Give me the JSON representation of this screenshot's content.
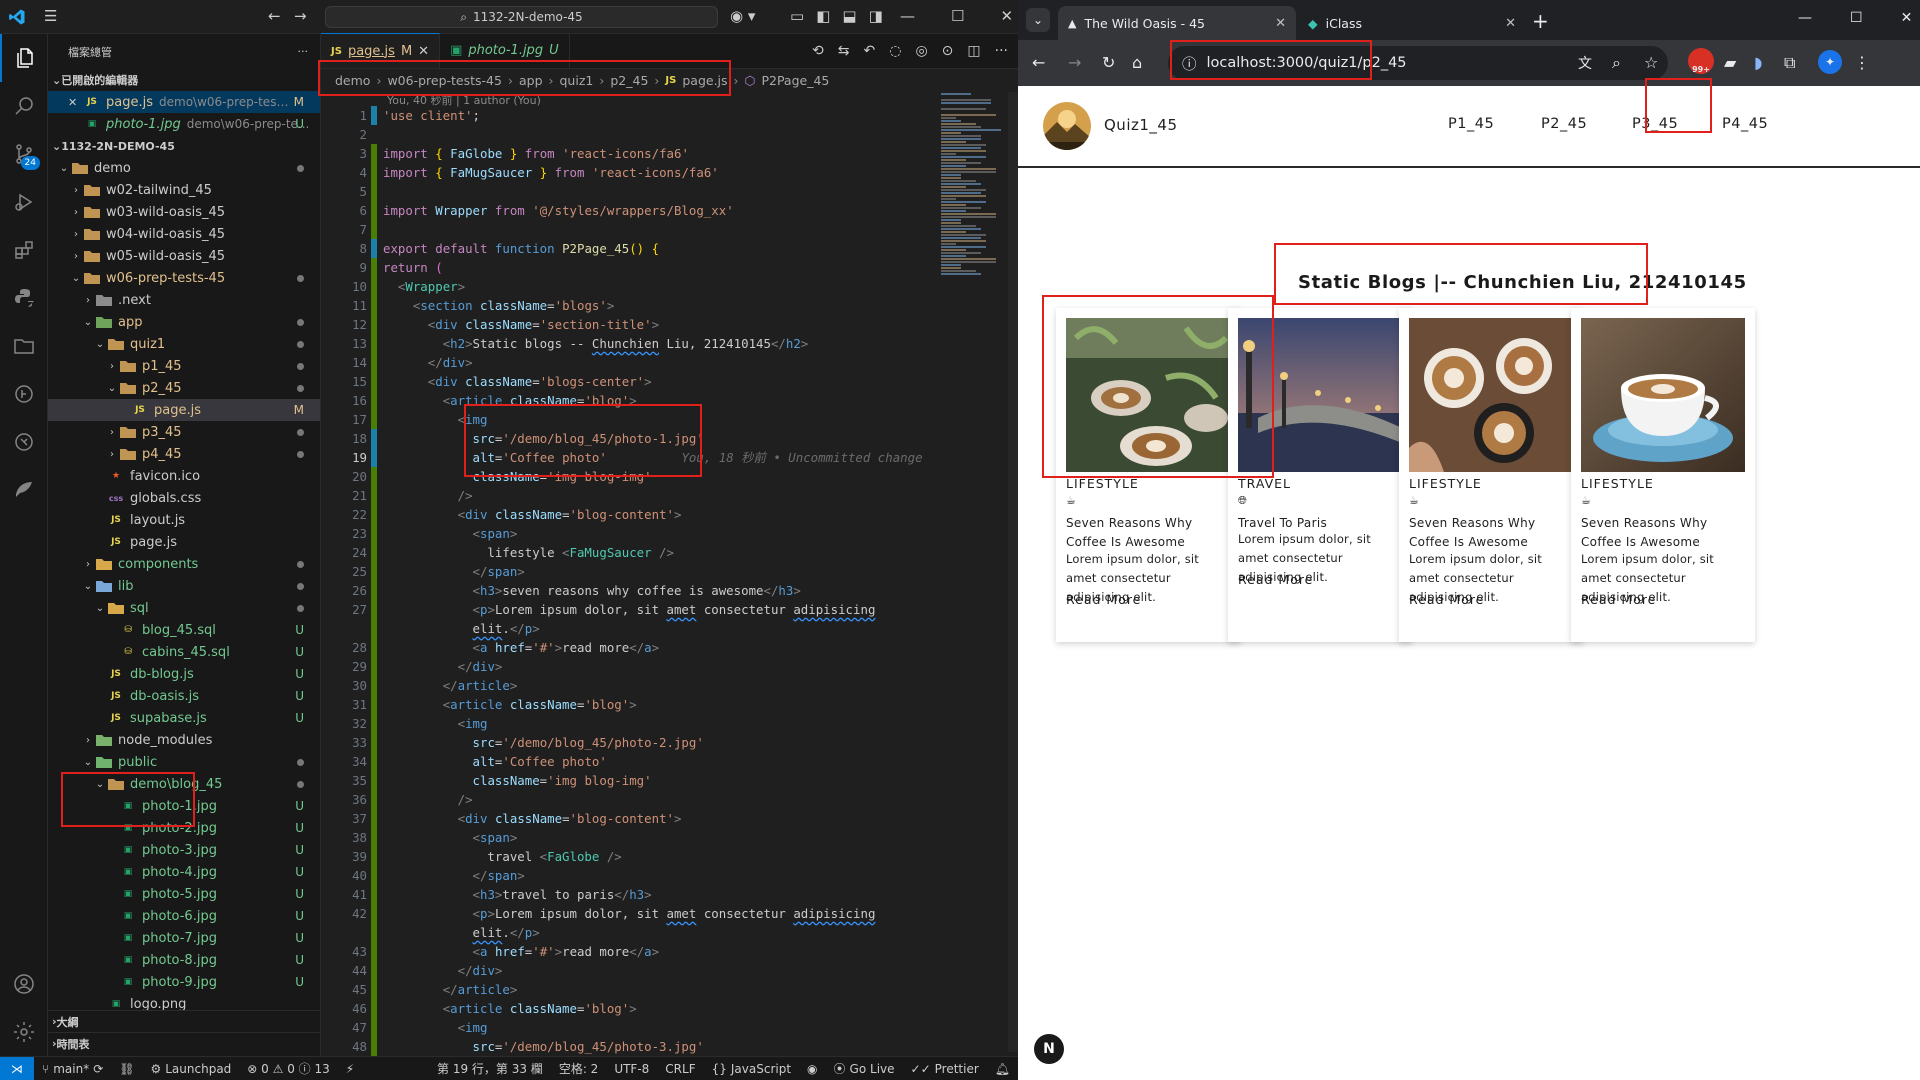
{
  "vscode": {
    "command_center": "1132-2N-demo-45",
    "explorer_title": "檔案總管",
    "explorer_more": "···",
    "open_editors_title": "已開啟的編輯器",
    "open_editors": [
      {
        "close": "✕",
        "name": "page.js",
        "desc": "demo\\w06-prep-tests-...",
        "status": "M"
      },
      {
        "name": "photo-1.jpg",
        "desc": "demo\\w06-prep-te...",
        "status": "U"
      }
    ],
    "workspace_title": "1132-2N-DEMO-45",
    "tree": [
      {
        "name": "demo",
        "type": "folder",
        "open": true,
        "level": 1,
        "status": "dot"
      },
      {
        "name": "w02-tailwind_45",
        "type": "folder",
        "level": 2
      },
      {
        "name": "w03-wild-oasis_45",
        "type": "folder",
        "level": 2
      },
      {
        "name": "w04-wild-oasis_45",
        "type": "folder",
        "level": 2
      },
      {
        "name": "w05-wild-oasis_45",
        "type": "folder",
        "level": 2
      },
      {
        "name": "w06-prep-tests-45",
        "type": "folder",
        "open": true,
        "level": 2,
        "status": "dot",
        "color": "modified"
      },
      {
        "name": ".next",
        "type": "folder-next",
        "level": 3
      },
      {
        "name": "app",
        "type": "folder-app",
        "open": true,
        "level": 3,
        "status": "dot",
        "color": "modified"
      },
      {
        "name": "quiz1",
        "type": "folder",
        "open": true,
        "level": 4,
        "status": "dot",
        "color": "modified"
      },
      {
        "name": "p1_45",
        "type": "folder",
        "level": 5,
        "status": "dot",
        "color": "modified"
      },
      {
        "name": "p2_45",
        "type": "folder",
        "open": true,
        "level": 5,
        "status": "dot",
        "color": "modified"
      },
      {
        "name": "page.js",
        "type": "js",
        "level": 6,
        "status": "M",
        "color": "modified",
        "selected": true
      },
      {
        "name": "p3_45",
        "type": "folder",
        "level": 5,
        "status": "dot",
        "color": "modified"
      },
      {
        "name": "p4_45",
        "type": "folder",
        "level": 5,
        "status": "dot",
        "color": "modified"
      },
      {
        "name": "favicon.ico",
        "type": "fav",
        "level": 4
      },
      {
        "name": "globals.css",
        "type": "css",
        "level": 4
      },
      {
        "name": "layout.js",
        "type": "js",
        "level": 4
      },
      {
        "name": "page.js",
        "type": "js",
        "level": 4
      },
      {
        "name": "components",
        "type": "folder-comp",
        "level": 3,
        "status": "dot",
        "color": "untracked"
      },
      {
        "name": "lib",
        "type": "folder-lib",
        "open": true,
        "level": 3,
        "status": "dot",
        "color": "untracked"
      },
      {
        "name": "sql",
        "type": "folder-sql",
        "open": true,
        "level": 4,
        "status": "dot",
        "color": "untracked"
      },
      {
        "name": "blog_45.sql",
        "type": "db",
        "level": 5,
        "status": "U",
        "color": "untracked"
      },
      {
        "name": "cabins_45.sql",
        "type": "db",
        "level": 5,
        "status": "U",
        "color": "untracked"
      },
      {
        "name": "db-blog.js",
        "type": "js",
        "level": 4,
        "status": "U",
        "color": "untracked"
      },
      {
        "name": "db-oasis.js",
        "type": "js",
        "level": 4,
        "status": "U",
        "color": "untracked"
      },
      {
        "name": "supabase.js",
        "type": "js",
        "level": 4,
        "status": "U",
        "color": "untracked"
      },
      {
        "name": "node_modules",
        "type": "folder-node",
        "level": 3
      },
      {
        "name": "public",
        "type": "folder-public",
        "open": true,
        "level": 3,
        "status": "dot",
        "color": "untracked"
      },
      {
        "name": "demo\\blog_45",
        "type": "folder",
        "open": true,
        "level": 4,
        "status": "dot",
        "color": "untracked"
      },
      {
        "name": "photo-1.jpg",
        "type": "img",
        "level": 5,
        "status": "U",
        "color": "untracked"
      },
      {
        "name": "photo-2.jpg",
        "type": "img",
        "level": 5,
        "status": "U",
        "color": "untracked"
      },
      {
        "name": "photo-3.jpg",
        "type": "img",
        "level": 5,
        "status": "U",
        "color": "untracked"
      },
      {
        "name": "photo-4.jpg",
        "type": "img",
        "level": 5,
        "status": "U",
        "color": "untracked"
      },
      {
        "name": "photo-5.jpg",
        "type": "img",
        "level": 5,
        "status": "U",
        "color": "untracked"
      },
      {
        "name": "photo-6.jpg",
        "type": "img",
        "level": 5,
        "status": "U",
        "color": "untracked"
      },
      {
        "name": "photo-7.jpg",
        "type": "img",
        "level": 5,
        "status": "U",
        "color": "untracked"
      },
      {
        "name": "photo-8.jpg",
        "type": "img",
        "level": 5,
        "status": "U",
        "color": "untracked"
      },
      {
        "name": "photo-9.jpg",
        "type": "img",
        "level": 5,
        "status": "U",
        "color": "untracked"
      },
      {
        "name": "logo.png",
        "type": "img",
        "level": 4
      }
    ],
    "outline_title": "大綱",
    "timeline_title": "時間表",
    "tabs": [
      {
        "name": "page.js",
        "status": "M",
        "active": true
      },
      {
        "name": "photo-1.jpg",
        "status": "U",
        "active": false
      }
    ],
    "breadcrumb": [
      "demo",
      "w06-prep-tests-45",
      "app",
      "quiz1",
      "p2_45",
      "page.js",
      "P2Page_45"
    ],
    "codelens": "You, 40 秒前 | 1 author (You)",
    "inline_blame": "You, 18 秒前 • Uncommitted change",
    "activity_badge": "24",
    "status": {
      "branch": "main*",
      "launchpad": "Launchpad",
      "problems": "⊗ 0 ⚠ 0 ⓘ 13",
      "position": "第 19 行，第 33 欄",
      "spaces": "空格: 2",
      "encoding": "UTF-8",
      "eol": "CRLF",
      "language": "JavaScript",
      "golive": "Go Live",
      "prettier": "Prettier"
    }
  },
  "chrome": {
    "tabs": [
      {
        "title": "The Wild Oasis - 45",
        "active": true
      },
      {
        "title": "iClass",
        "active": false
      }
    ],
    "url": "localhost:3000/quiz1/p2_45",
    "ext_badge": "99+"
  },
  "site": {
    "name": "Quiz1_45",
    "nav": [
      "P1_45",
      "P2_45",
      "P3_45",
      "P4_45"
    ],
    "section_title": "Static Blogs |-- Chunchien Liu, 212410145",
    "cards": [
      {
        "category": "LIFESTYLE",
        "icon": "mug-saucer-icon",
        "title": "Seven Reasons Why Coffee Is Awesome",
        "body": "Lorem ipsum dolor, sit amet consectetur adipisicing elit.",
        "more": "Read More"
      },
      {
        "category": "TRAVEL",
        "icon": "globe-icon",
        "title": "Travel To Paris",
        "body": "Lorem ipsum dolor, sit amet consectetur adipisicing elit.",
        "more": "Read More"
      },
      {
        "category": "LIFESTYLE",
        "icon": "mug-saucer-icon",
        "title": "Seven Reasons Why Coffee Is Awesome",
        "body": "Lorem ipsum dolor, sit amet consectetur adipisicing elit.",
        "more": "Read More"
      },
      {
        "category": "LIFESTYLE",
        "icon": "mug-saucer-icon",
        "title": "Seven Reasons Why Coffee Is Awesome",
        "body": "Lorem ipsum dolor, sit amet consectetur adipisicing elit.",
        "more": "Read More"
      }
    ],
    "next_badge": "N"
  },
  "colors": {
    "accent": "#0078d4",
    "annotation_red": "#e0201b",
    "modified": "#e2c08d",
    "untracked": "#73c991"
  }
}
